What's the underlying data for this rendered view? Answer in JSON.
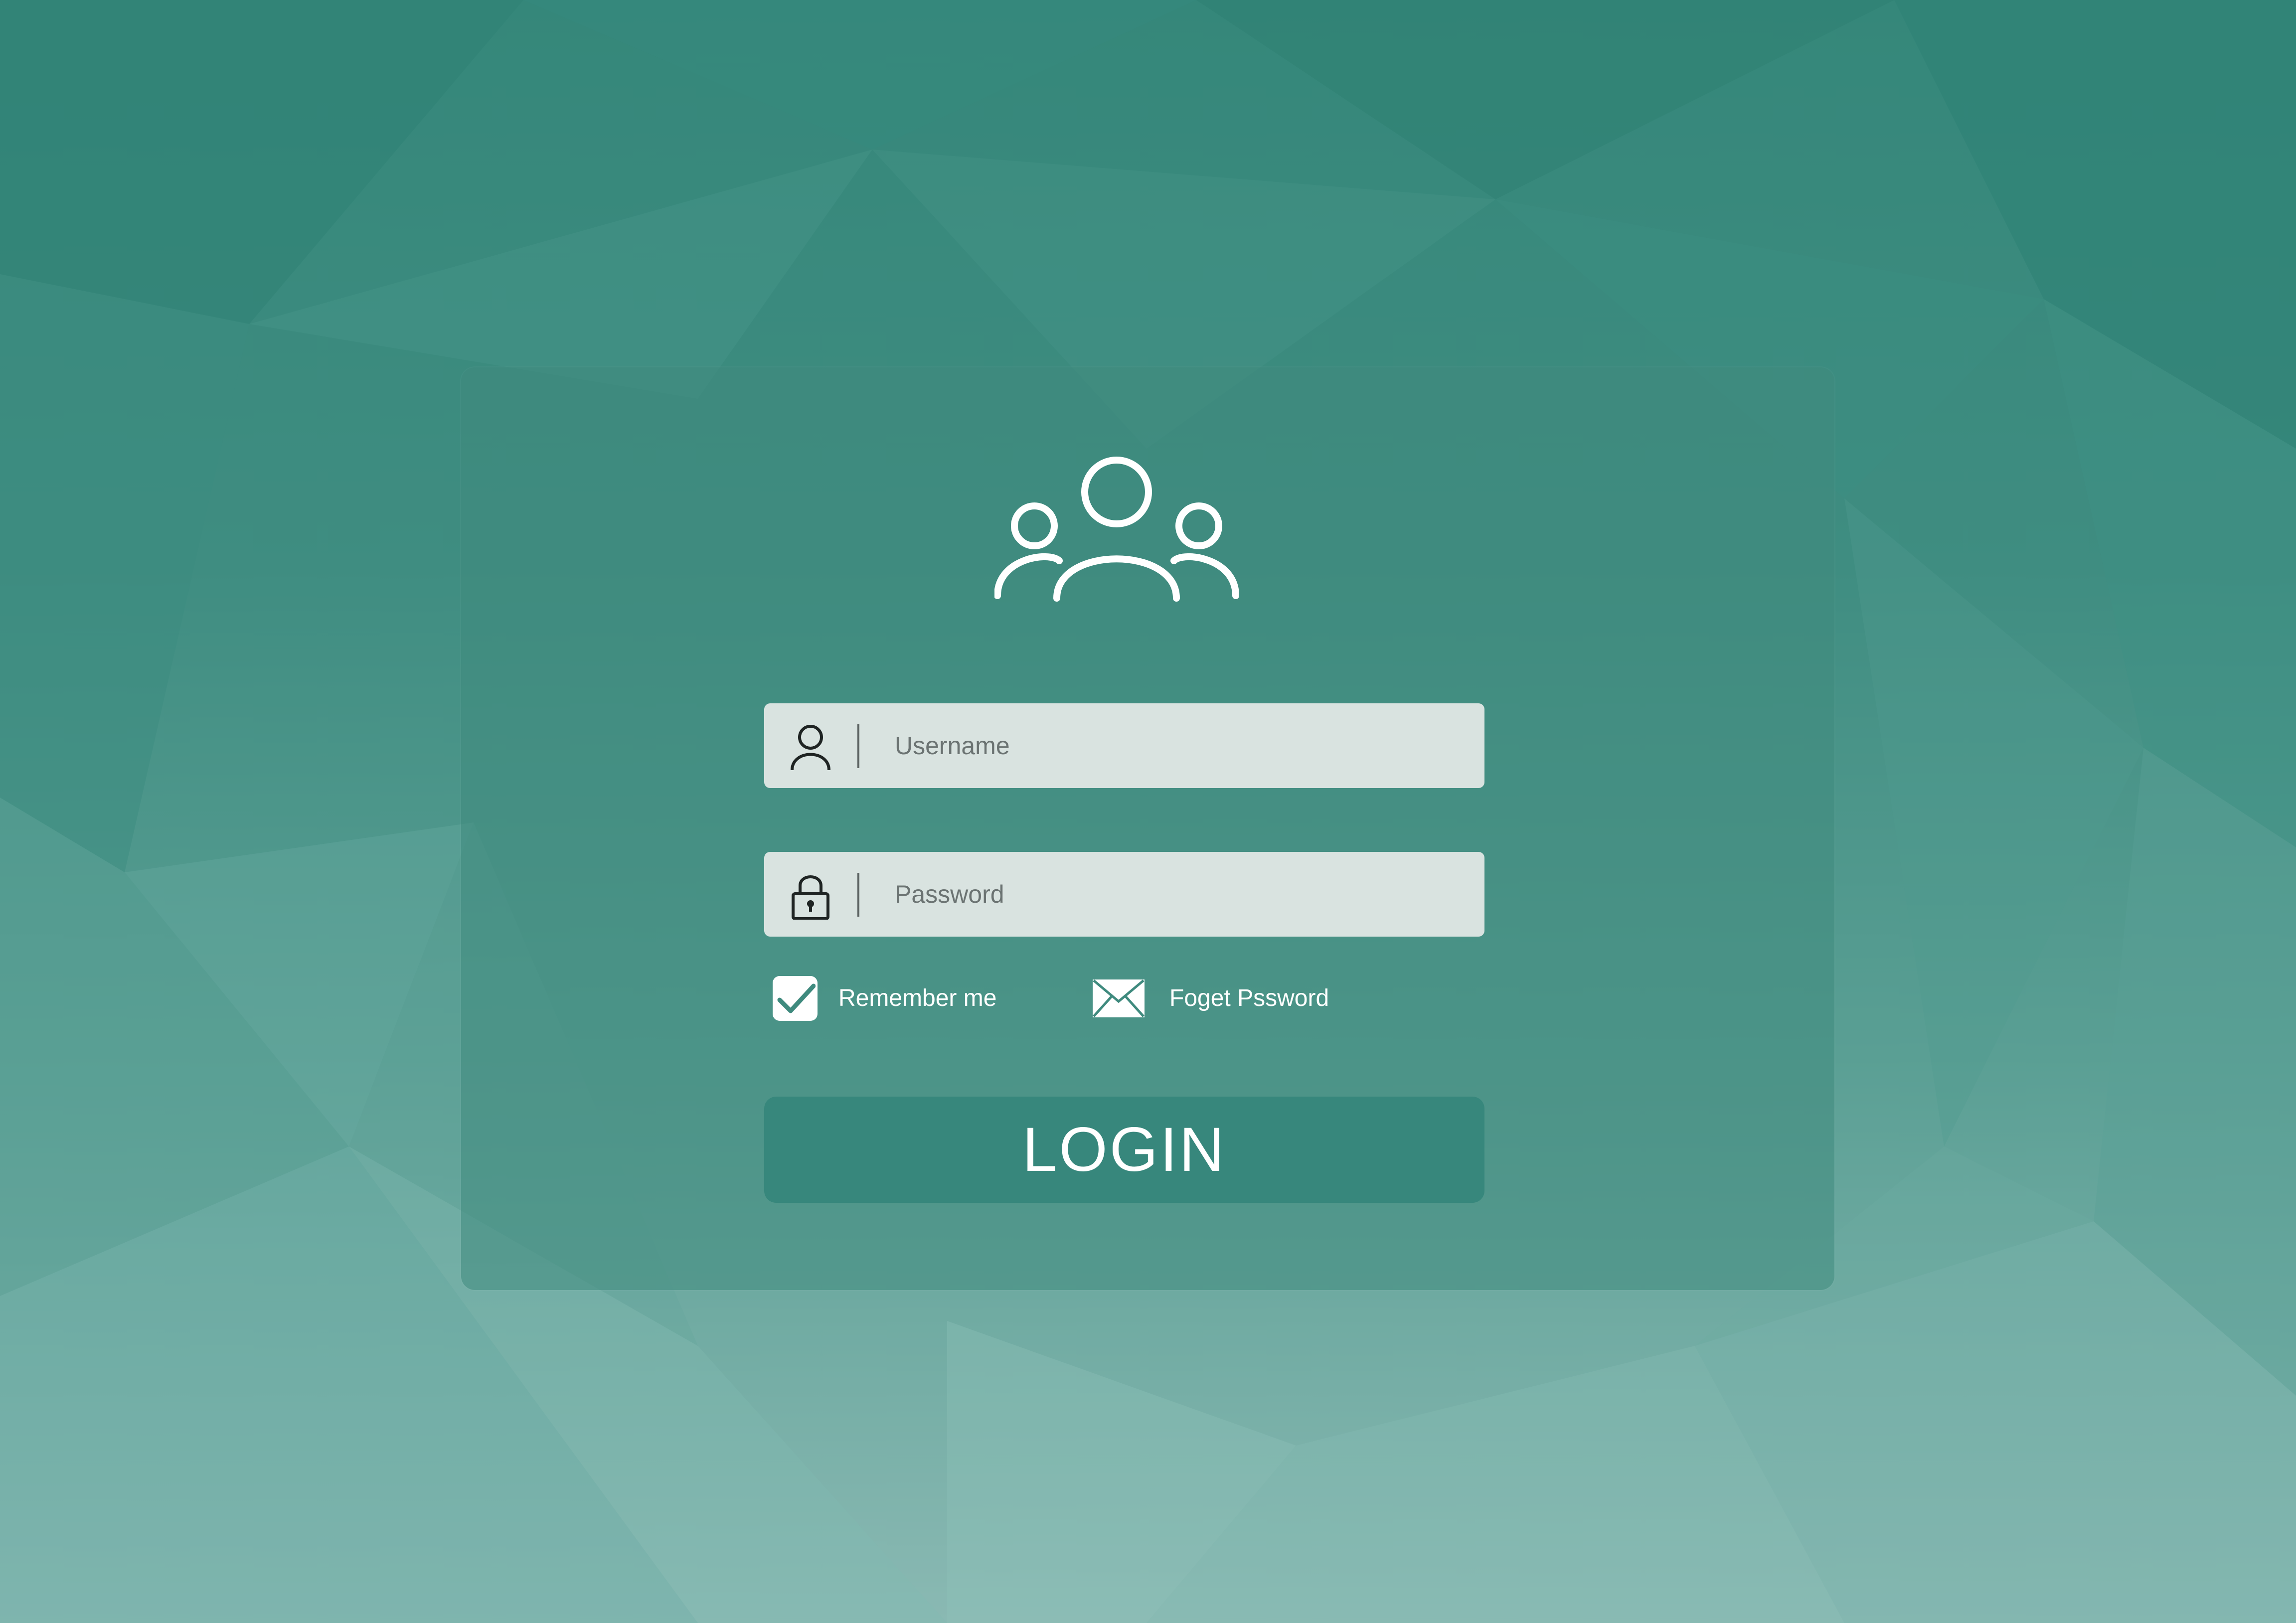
{
  "colors": {
    "background_top": "#35877a",
    "background_bottom": "#8ab9b3",
    "panel": "#3f8a7e",
    "field_background": "#d9e3e0",
    "button": "#37877c",
    "text_light": "#ffffff",
    "placeholder_text": "#6b7372"
  },
  "header": {
    "icon": "users-group-icon"
  },
  "form": {
    "username": {
      "icon": "user-icon",
      "placeholder": "Username",
      "value": ""
    },
    "password": {
      "icon": "lock-icon",
      "placeholder": "Password",
      "value": ""
    },
    "remember": {
      "label": "Remember me",
      "checked": true,
      "icon": "checkmark-icon"
    },
    "forgot": {
      "label": "Foget Pssword",
      "icon": "envelope-icon"
    },
    "submit_label": "LOGIN"
  }
}
